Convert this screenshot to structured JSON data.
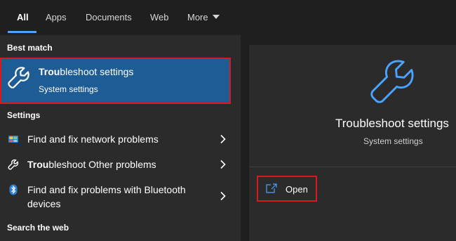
{
  "tabs": [
    {
      "label": "All",
      "active": true
    },
    {
      "label": "Apps"
    },
    {
      "label": "Documents"
    },
    {
      "label": "Web"
    },
    {
      "label": "More"
    }
  ],
  "sections": {
    "best_match": "Best match",
    "settings": "Settings",
    "search_web": "Search the web"
  },
  "best_match": {
    "title_bold": "Trou",
    "title_rest": "bleshoot settings",
    "subtitle": "System settings",
    "icon": "wrench-icon"
  },
  "settings_items": [
    {
      "label": "Find and fix network problems",
      "icon": "network-icon"
    },
    {
      "label_bold": "Trou",
      "label_rest": "bleshoot Other problems",
      "icon": "wrench-icon"
    },
    {
      "label": "Find and fix problems with Bluetooth devices",
      "label_line1": "Find and fix problems with Bluetooth",
      "label_line2": "devices",
      "icon": "bluetooth-icon"
    }
  ],
  "preview": {
    "title": "Troubleshoot settings",
    "subtitle": "System settings",
    "icon": "wrench-icon"
  },
  "actions": {
    "open_label": "Open",
    "open_icon": "open-external-icon"
  },
  "colors": {
    "accent": "#4aa3ff",
    "selection": "#1d5c94",
    "highlight_border": "#d71920",
    "panel": "#2b2b2b",
    "background": "#1f1f1f"
  }
}
